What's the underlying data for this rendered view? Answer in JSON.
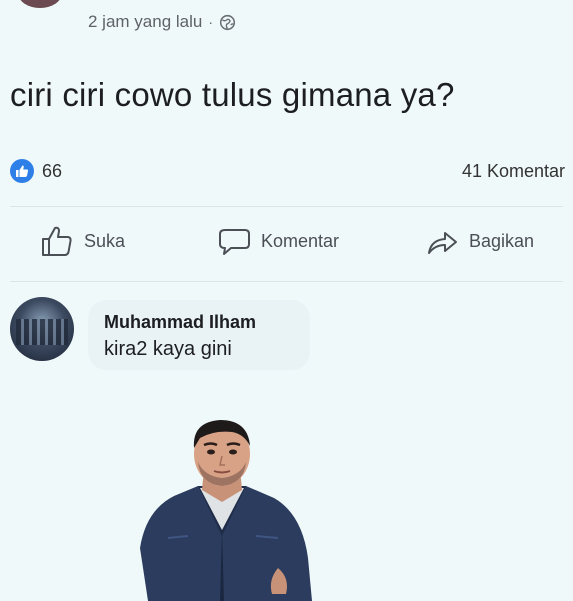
{
  "post": {
    "time": "2 jam yang lalu",
    "separator": "·",
    "privacy_icon": "globe-icon",
    "text": "ciri ciri cowo tulus gimana ya?"
  },
  "stats": {
    "likes": "66",
    "comments": "41 Komentar"
  },
  "actions": {
    "like_label": "Suka",
    "comment_label": "Komentar",
    "share_label": "Bagikan"
  },
  "comment": {
    "author": "Muhammad Ilham",
    "text": "kira2 kaya gini"
  },
  "colors": {
    "background": "#f0f9fa",
    "like_blue": "#2e7fe8",
    "bubble": "#e9f3f6",
    "jacket": "#2b3c5e"
  }
}
